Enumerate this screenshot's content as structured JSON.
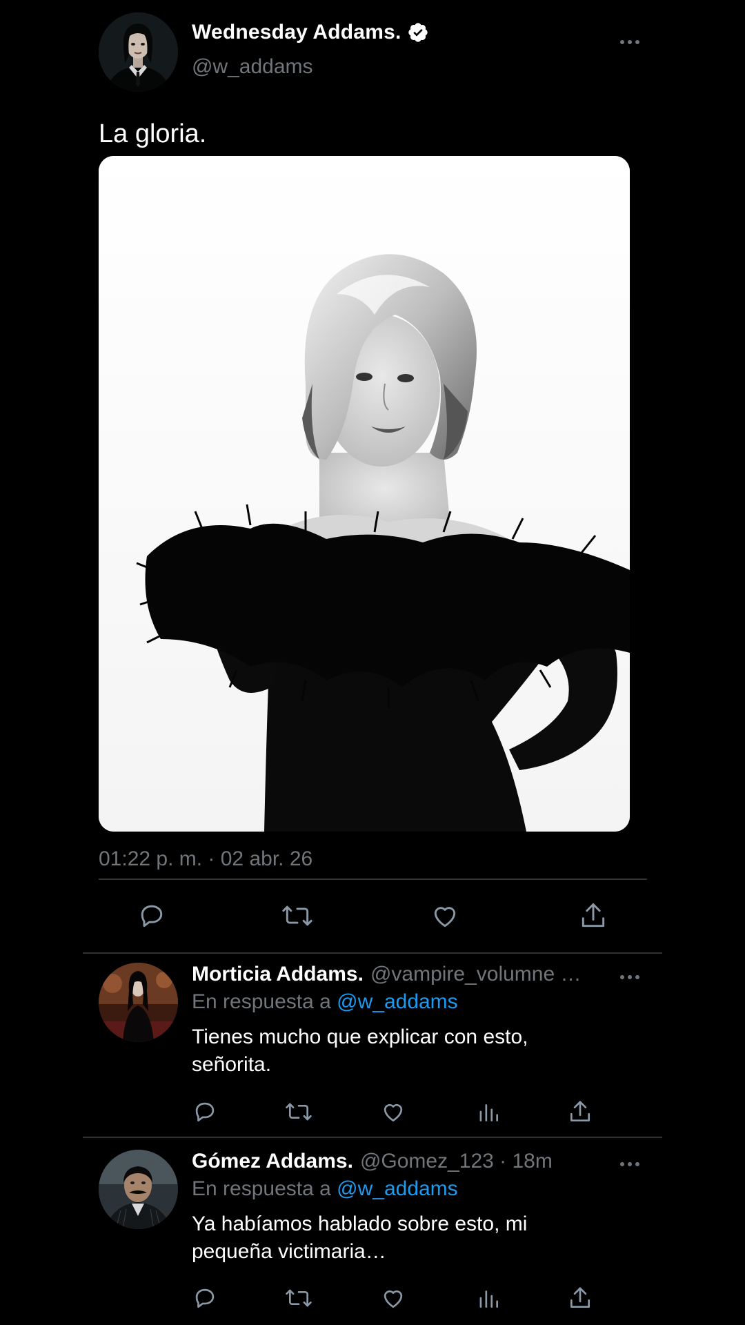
{
  "main_tweet": {
    "author_name": "Wednesday Addams.",
    "author_handle": "@w_addams",
    "text": "La gloria.",
    "timestamp": "01:22 p. m. · 02 abr. 26",
    "icons": {
      "verified": "verified-badge-icon",
      "more": "more-options-icon",
      "reply": "reply-icon",
      "retweet": "retweet-icon",
      "like": "heart-icon",
      "share": "share-icon"
    }
  },
  "replies": [
    {
      "author_name": "Morticia Addams.",
      "author_handle": "@vampire_volumne …",
      "reply_prefix": "En respuesta a",
      "reply_mention": "@w_addams",
      "text": "Tienes mucho que explicar con esto, señorita."
    },
    {
      "author_name": "Gómez Addams.",
      "author_handle": "@Gomez_123 · 18m",
      "reply_prefix": "En respuesta a",
      "reply_mention": "@w_addams",
      "text": "Ya habíamos hablado sobre esto, mi pequeña victimaria…"
    }
  ],
  "colors": {
    "background": "#000000",
    "primary_text": "#ffffff",
    "secondary_text": "#71767b",
    "accent": "#1d9bf0",
    "divider": "#2f3336"
  }
}
